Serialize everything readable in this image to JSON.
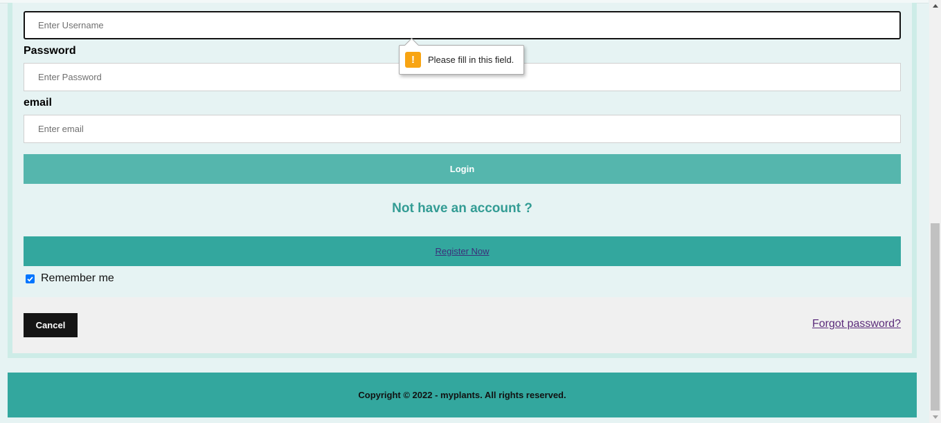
{
  "form": {
    "username_placeholder": "Enter Username",
    "password_label": "Password",
    "password_placeholder": "Enter Password",
    "email_label": "email",
    "email_placeholder": "Enter email",
    "login_label": "Login",
    "not_account_text": "Not have an account ?",
    "register_label": "Register Now",
    "remember_label": "Remember me",
    "remember_checked": true,
    "cancel_label": "Cancel",
    "forgot_label": "Forgot password?"
  },
  "validation": {
    "message": "Please fill in this field.",
    "icon": "warning-icon"
  },
  "footer": {
    "copyright": "Copyright © 2022 - myplants. All rights reserved."
  },
  "colors": {
    "page_background": "#e6f3f3",
    "login_button": "#55b6ad",
    "register_button": "#33a79e",
    "accent_text": "#339c94",
    "cancel_button": "#151515",
    "warning": "#f8a412"
  }
}
